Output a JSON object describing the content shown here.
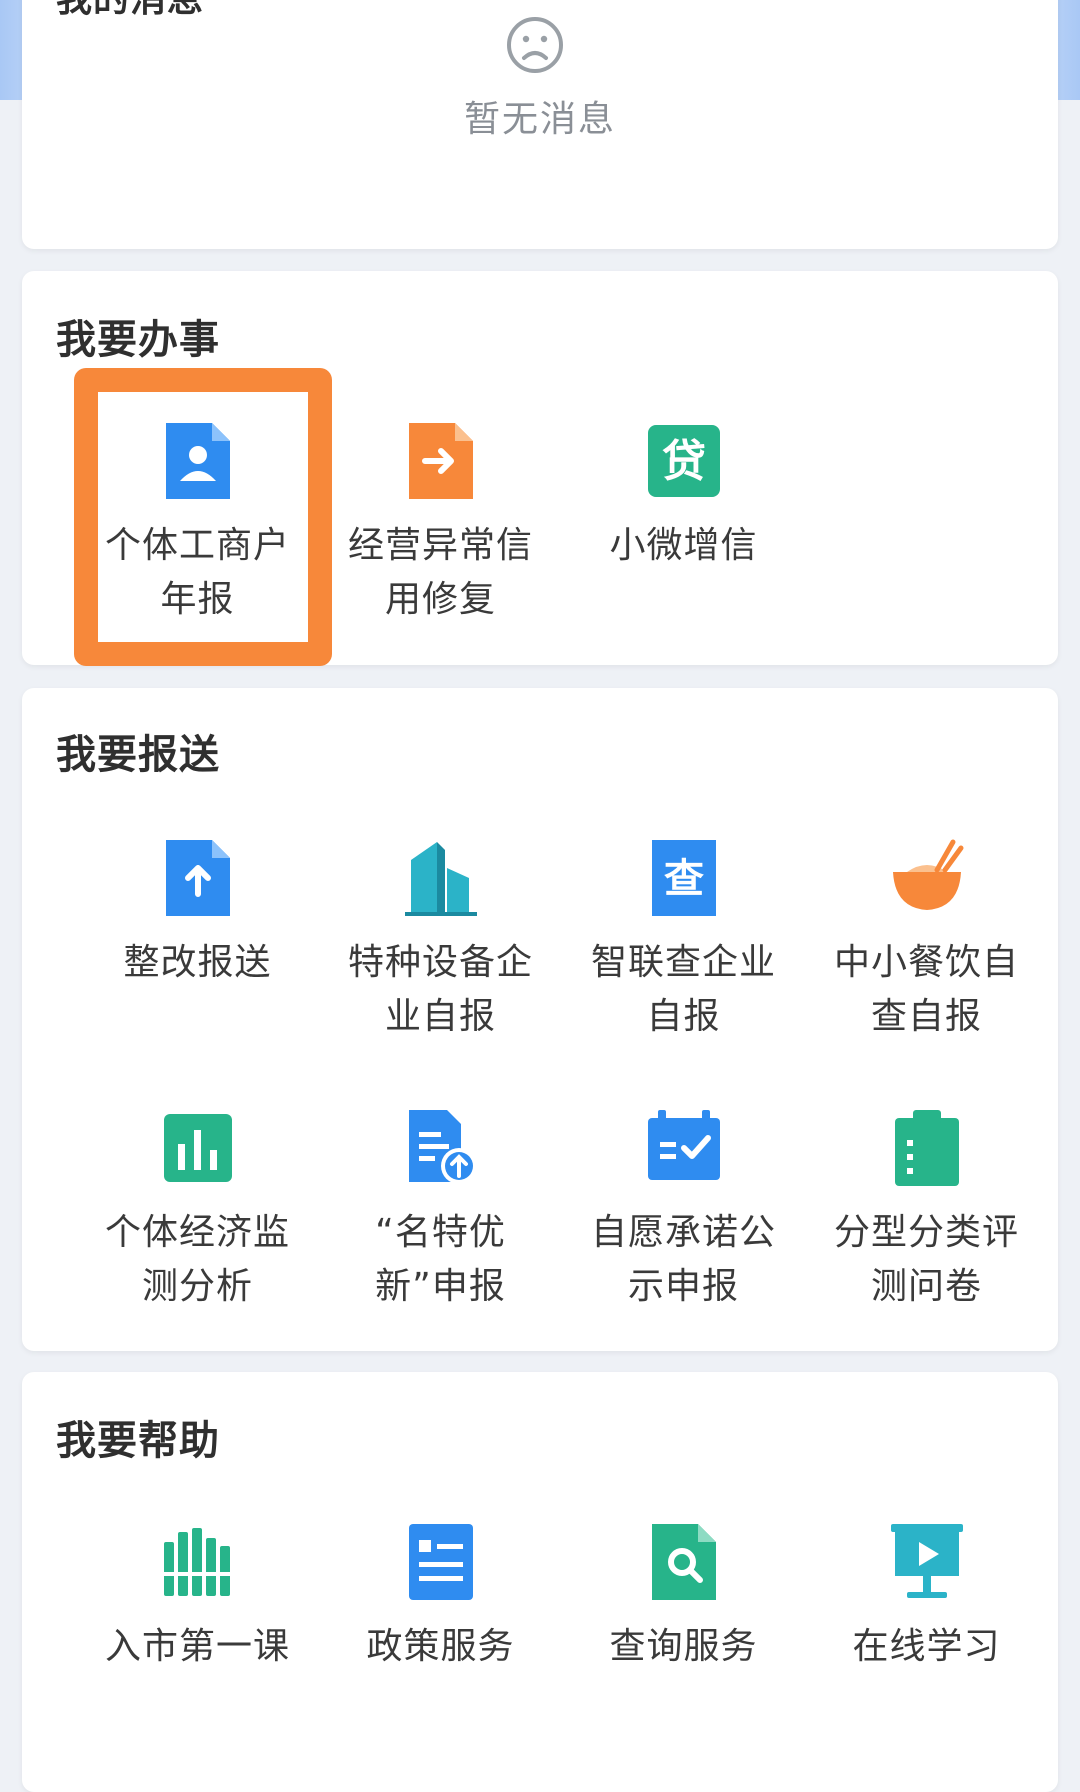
{
  "messages": {
    "title": "我的消息",
    "empty_text": "暂无消息"
  },
  "work": {
    "title": "我要办事",
    "items": [
      {
        "label": "个体工商户年报",
        "icon": "person-doc-icon"
      },
      {
        "label": "经营异常信用修复",
        "icon": "arrow-doc-icon"
      },
      {
        "label": "小微增信",
        "icon": "loan-icon"
      }
    ]
  },
  "report": {
    "title": "我要报送",
    "items": [
      {
        "label": "整改报送",
        "icon": "upload-doc-icon"
      },
      {
        "label": "特种设备企业自报",
        "icon": "building-icon"
      },
      {
        "label": "智联查企业自报",
        "icon": "check-doc-icon"
      },
      {
        "label": "中小餐饮自查自报",
        "icon": "bowl-icon"
      },
      {
        "label": "个体经济监测分析",
        "icon": "bar-chart-icon"
      },
      {
        "label": "“名特优新”申报",
        "icon": "doc-upload-icon"
      },
      {
        "label": "自愿承诺公示申报",
        "icon": "calendar-check-icon"
      },
      {
        "label": "分型分类评测问卷",
        "icon": "clipboard-icon"
      }
    ]
  },
  "help": {
    "title": "我要帮助",
    "items": [
      {
        "label": "入市第一课",
        "icon": "books-icon"
      },
      {
        "label": "政策服务",
        "icon": "policy-doc-icon"
      },
      {
        "label": "查询服务",
        "icon": "search-doc-icon"
      },
      {
        "label": "在线学习",
        "icon": "presentation-icon"
      }
    ]
  },
  "colors": {
    "blue": "#2f8cf0",
    "orange": "#f7883a",
    "green": "#27b48a",
    "highlight": "#f7883a"
  }
}
